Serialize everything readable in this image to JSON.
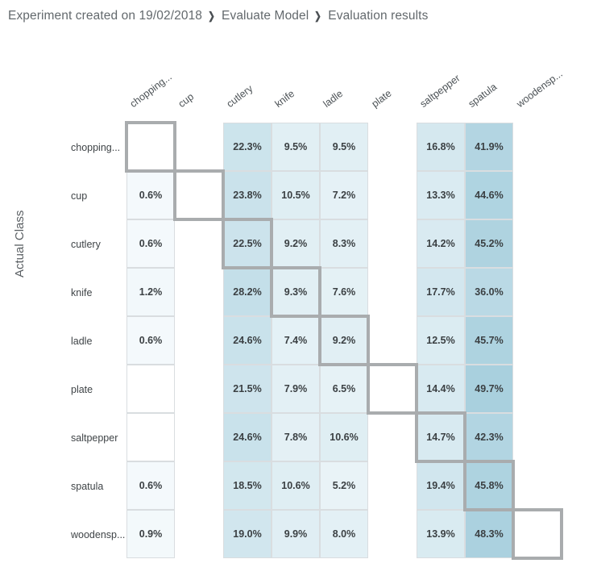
{
  "breadcrumb": {
    "items": [
      "Experiment created on 19/02/2018",
      "Evaluate Model",
      "Evaluation results"
    ],
    "separator": "❯"
  },
  "axis": {
    "y_title": "Actual Class"
  },
  "colors": {
    "grid_line": "#d9dde0",
    "diagonal_border": "#a9acae",
    "text": "#3b4043",
    "scale_min": "#f7fbfd",
    "scale_max": "#b3d4e0",
    "breadcrumb_text": "#666b6f"
  },
  "chart_data": {
    "type": "heatmap",
    "title": "Confusion matrix",
    "xlabel": "",
    "ylabel": "Actual Class",
    "value_suffix": "%",
    "grid": true,
    "legend": "none",
    "columns": [
      "chopping...",
      "cup",
      "cutlery",
      "knife",
      "ladle",
      "plate",
      "saltpepper",
      "spatula",
      "woodensp..."
    ],
    "rows": [
      "chopping...",
      "cup",
      "cutlery",
      "knife",
      "ladle",
      "plate",
      "saltpepper",
      "spatula",
      "woodensp..."
    ],
    "zrange": [
      0,
      49.7
    ],
    "cells": [
      [
        "",
        "",
        "22.3%",
        "9.5%",
        "9.5%",
        "",
        "16.8%",
        "41.9%",
        ""
      ],
      [
        "0.6%",
        "",
        "23.8%",
        "10.5%",
        "7.2%",
        "",
        "13.3%",
        "44.6%",
        ""
      ],
      [
        "0.6%",
        "",
        "22.5%",
        "9.2%",
        "8.3%",
        "",
        "14.2%",
        "45.2%",
        ""
      ],
      [
        "1.2%",
        "",
        "28.2%",
        "9.3%",
        "7.6%",
        "",
        "17.7%",
        "36.0%",
        ""
      ],
      [
        "0.6%",
        "",
        "24.6%",
        "7.4%",
        "9.2%",
        "",
        "12.5%",
        "45.7%",
        ""
      ],
      [
        "",
        "",
        "21.5%",
        "7.9%",
        "6.5%",
        "",
        "14.4%",
        "49.7%",
        ""
      ],
      [
        "",
        "",
        "24.6%",
        "7.8%",
        "10.6%",
        "",
        "14.7%",
        "42.3%",
        ""
      ],
      [
        "0.6%",
        "",
        "18.5%",
        "10.6%",
        "5.2%",
        "",
        "19.4%",
        "45.8%",
        ""
      ],
      [
        "0.9%",
        "",
        "19.0%",
        "9.9%",
        "8.0%",
        "",
        "13.9%",
        "48.3%",
        ""
      ]
    ],
    "values": [
      [
        null,
        null,
        22.3,
        9.5,
        9.5,
        null,
        16.8,
        41.9,
        null
      ],
      [
        0.6,
        null,
        23.8,
        10.5,
        7.2,
        null,
        13.3,
        44.6,
        null
      ],
      [
        0.6,
        null,
        22.5,
        9.2,
        8.3,
        null,
        14.2,
        45.2,
        null
      ],
      [
        1.2,
        null,
        28.2,
        9.3,
        7.6,
        null,
        17.7,
        36.0,
        null
      ],
      [
        0.6,
        null,
        24.6,
        7.4,
        9.2,
        null,
        12.5,
        45.7,
        null
      ],
      [
        null,
        null,
        21.5,
        7.9,
        6.5,
        null,
        14.4,
        49.7,
        null
      ],
      [
        null,
        null,
        24.6,
        7.8,
        10.6,
        null,
        14.7,
        42.3,
        null
      ],
      [
        0.6,
        null,
        18.5,
        10.6,
        5.2,
        null,
        19.4,
        45.8,
        null
      ],
      [
        0.9,
        null,
        19.0,
        9.9,
        8.0,
        null,
        13.9,
        48.3,
        null
      ]
    ],
    "empty_columns": [
      "cup",
      "plate",
      "woodensp..."
    ],
    "diagonal_highlight": true
  }
}
